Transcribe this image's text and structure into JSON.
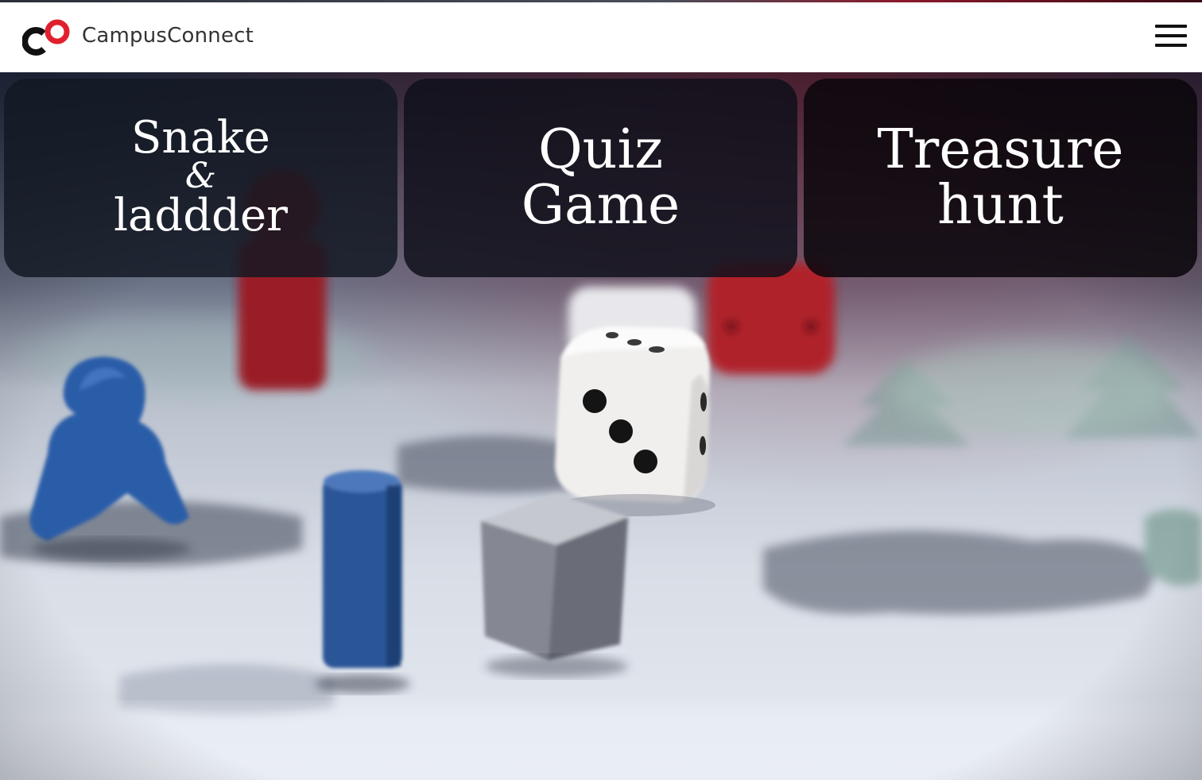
{
  "header": {
    "brand_name": "CampusConnect",
    "logo_icon": "campusconnect-logo-icon",
    "menu_icon": "hamburger-menu-icon"
  },
  "cards": [
    {
      "line1": "Snake",
      "line2": "&",
      "line3": "laddder"
    },
    {
      "line1": "Quiz",
      "line2": "Game"
    },
    {
      "line1": "Treasure",
      "line2": "hunt"
    }
  ],
  "colors": {
    "brand_red": "#e0202e",
    "brand_dark": "#111111",
    "card_overlay": "#0c101a"
  }
}
